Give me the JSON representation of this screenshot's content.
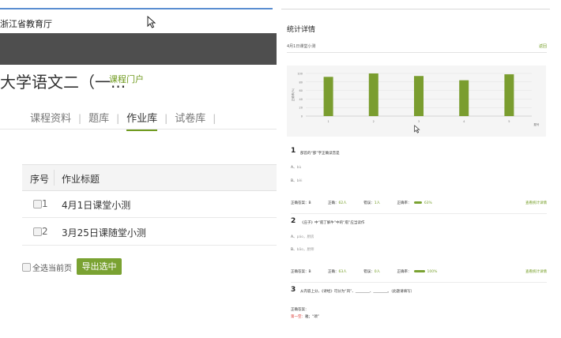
{
  "left": {
    "org_name": "浙江省教育厅",
    "course_title": "大学语文二（一...",
    "portal_link": "课程门户",
    "tabs": [
      {
        "label": "课程资料",
        "active": false
      },
      {
        "label": "题库",
        "active": false
      },
      {
        "label": "作业库",
        "active": true
      },
      {
        "label": "试卷库",
        "active": false
      }
    ],
    "table": {
      "headers": {
        "index": "序号",
        "title": "作业标题"
      },
      "rows": [
        {
          "index": "1",
          "title": "4月1日课堂小测"
        },
        {
          "index": "2",
          "title": "3月25日课随堂小测"
        }
      ]
    },
    "select_page_label": "全选当前页",
    "export_button": "导出选中"
  },
  "right": {
    "title": "统计详情",
    "quiz_name": "4月1日课堂小测",
    "back_link": "返回",
    "chart_data": {
      "type": "bar",
      "categories": [
        "1",
        "2",
        "3",
        "4",
        "5"
      ],
      "values": [
        92,
        100,
        94,
        84,
        98
      ],
      "ylabel": "正确率(%)",
      "xlabel": "题号",
      "yticks": [
        "0",
        "20",
        "40",
        "60",
        "80",
        "100"
      ],
      "ylim": [
        0,
        100
      ],
      "grid": true,
      "color": "#7a9d2f"
    },
    "questions": [
      {
        "number": "1",
        "text": "部首的“部”字正确读音是",
        "options": [
          {
            "letter": "A、",
            "text": "bù"
          },
          {
            "letter": "B、",
            "text": "bèi"
          }
        ],
        "stats": {
          "correct_answer_label": "正确答案：B",
          "correct_label": "正确：",
          "correct_count": "62人",
          "wrong_label": "错误：",
          "wrong_count": "1人",
          "rate_label": "正确率：",
          "rate_value": "63%",
          "rate": 0.63,
          "detail_link": "查看统计详情"
        }
      },
      {
        "number": "2",
        "text": "《庄子》中“庖丁解牛”中的“庖”应当读作",
        "options": [
          {
            "letter": "A、",
            "text": "páo，厨房"
          },
          {
            "letter": "B、",
            "text": "bāo，厨师"
          }
        ],
        "stats": {
          "correct_answer_label": "正确答案：B",
          "correct_label": "正确：",
          "correct_count": "63人",
          "wrong_label": "错误：",
          "wrong_count": "0人",
          "rate_label": "正确率：",
          "rate_value": "100%",
          "rate": 1.0,
          "detail_link": "查看统计详情"
        }
      }
    ],
    "question3": {
      "number": "3",
      "text": "从内容上分，《诗经》可分为“风”、________、________。（此题请填写）",
      "answer_label": "正确答案：",
      "blank_label": "第一空：",
      "blank_answer": "雅；“颂”"
    }
  },
  "colors": {
    "accent": "#7aa232",
    "link": "#6f9a1e",
    "dark_header": "#4e4e4e"
  }
}
